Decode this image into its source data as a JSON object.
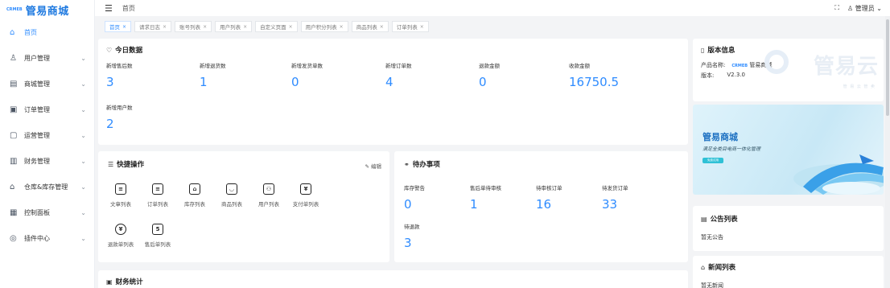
{
  "brand": {
    "mini": "CRMEB",
    "title": "管易商城"
  },
  "nav": [
    {
      "key": "home",
      "icon": "home-icon",
      "glyph": "⌂",
      "label": "首页",
      "active": true,
      "chevron": false
    },
    {
      "key": "users",
      "icon": "user-icon",
      "glyph": "♙",
      "label": "用户管理",
      "chevron": true
    },
    {
      "key": "mall",
      "icon": "store-icon",
      "glyph": "▤",
      "label": "商城管理",
      "chevron": true
    },
    {
      "key": "orders",
      "icon": "order-icon",
      "glyph": "▣",
      "label": "订单管理",
      "chevron": true
    },
    {
      "key": "ops",
      "icon": "operation-icon",
      "glyph": "▢",
      "label": "运营管理",
      "chevron": true
    },
    {
      "key": "finance",
      "icon": "wallet-icon",
      "glyph": "▥",
      "label": "财务管理",
      "chevron": true
    },
    {
      "key": "warehouse",
      "icon": "warehouse-icon",
      "glyph": "⌂",
      "label": "仓库&库存管理",
      "chevron": true
    },
    {
      "key": "dashboard",
      "icon": "dashboard-icon",
      "glyph": "▦",
      "label": "控制面板",
      "chevron": true
    },
    {
      "key": "plugins",
      "icon": "plugin-icon",
      "glyph": "◎",
      "label": "插件中心",
      "chevron": true
    }
  ],
  "topbar": {
    "breadcrumb": "首页",
    "user": "管理员",
    "fullscreen_glyph": "⛶",
    "user_glyph": "♙",
    "caret": "⌄"
  },
  "tabs": [
    {
      "label": "首页",
      "active": true
    },
    {
      "label": "请求日志"
    },
    {
      "label": "账号列表"
    },
    {
      "label": "用户列表"
    },
    {
      "label": "自定义页面"
    },
    {
      "label": "用户积分列表"
    },
    {
      "label": "商品列表"
    },
    {
      "label": "订单列表"
    }
  ],
  "today": {
    "title": "今日数据",
    "stats": [
      {
        "label": "新增售后数",
        "value": "3"
      },
      {
        "label": "新增退货数",
        "value": "1"
      },
      {
        "label": "新增发货单数",
        "value": "0"
      },
      {
        "label": "新增订单数",
        "value": "4"
      },
      {
        "label": "退款金额",
        "value": "0"
      },
      {
        "label": "收款金额",
        "value": "16750.5"
      },
      {
        "label": "新增用户数",
        "value": "2"
      }
    ]
  },
  "quick": {
    "title": "快捷操作",
    "edit": "编辑",
    "items": [
      {
        "icon": "article-list-icon",
        "glyph": "≡",
        "label": "文章列表"
      },
      {
        "icon": "order-list-icon",
        "glyph": "≡",
        "label": "订单列表"
      },
      {
        "icon": "inventory-icon",
        "glyph": "⌂",
        "label": "库存列表"
      },
      {
        "icon": "shopping-bag-icon",
        "glyph": "◡",
        "label": "商品列表"
      },
      {
        "icon": "users-icon",
        "glyph": "⚇",
        "label": "用户列表"
      },
      {
        "icon": "payment-icon",
        "glyph": "¥",
        "label": "支付单列表"
      },
      {
        "icon": "refund-icon",
        "glyph": "¥",
        "label": "退款单列表"
      },
      {
        "icon": "after-sale-icon",
        "glyph": "5",
        "label": "售后单列表"
      }
    ]
  },
  "todo": {
    "title": "待办事项",
    "stats": [
      {
        "label": "库存警告",
        "value": "0"
      },
      {
        "label": "售后单待审核",
        "value": "1"
      },
      {
        "label": "待审核订单",
        "value": "16"
      },
      {
        "label": "待发货订单",
        "value": "33"
      },
      {
        "label": "待退款",
        "value": "3"
      }
    ]
  },
  "finance": {
    "title": "财务统计"
  },
  "version": {
    "title": "版本信息",
    "product_label": "产品名称:",
    "product_mini": "CRMEB",
    "product_value": "管易商城",
    "version_label": "版本:",
    "version_value": "V2.3.0",
    "logo_text": "管易云",
    "logo_sub": "管 易 云  管 卖"
  },
  "banner": {
    "title": "管易商城",
    "subtitle": "满足全类目电商一体化管理",
    "button": "免费试用"
  },
  "notice": {
    "title": "公告列表",
    "empty": "暂无公告"
  },
  "news": {
    "title": "新闻列表",
    "empty": "暂无新闻"
  },
  "colors": {
    "accent": "#2f8cff",
    "brand": "#1f7ae0"
  }
}
